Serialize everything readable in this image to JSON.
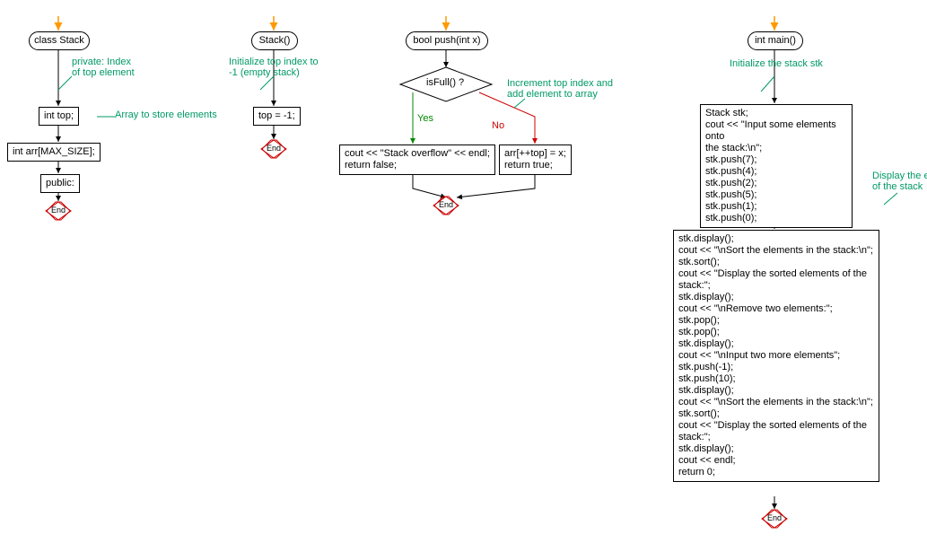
{
  "fc1": {
    "title": "class Stack",
    "ann1": "private: Index\nof top element",
    "n1": "int top;",
    "ann2": "Array to store elements",
    "n2": "int arr[MAX_SIZE];",
    "n3": "public:",
    "end": "End"
  },
  "fc2": {
    "title": "Stack()",
    "ann1": "Initialize top index to\n-1 (empty stack)",
    "n1": "top = -1;",
    "end": "End"
  },
  "fc3": {
    "title": "bool push(int x)",
    "cond": "isFull() ?",
    "yes": "Yes",
    "no": "No",
    "ann1": "Increment top index and\nadd element to array",
    "left": "cout << \"Stack overflow\" << endl;\nreturn false;",
    "right": "arr[++top] = x;\nreturn true;",
    "end": "End"
  },
  "fc4": {
    "title": "int main()",
    "ann1": "Initialize the stack stk",
    "block1": "Stack stk;\ncout << \"Input some elements onto\nthe stack:\\n\";\nstk.push(7);\nstk.push(4);\nstk.push(2);\nstk.push(5);\nstk.push(1);\nstk.push(0);",
    "ann2": "Display the elements\nof the stack",
    "block2": "stk.display();\ncout << \"\\nSort the elements in the stack:\\n\";\nstk.sort();\ncout << \"Display the sorted elements of the\nstack:\";\nstk.display();\ncout << \"\\nRemove two elements:\";\nstk.pop();\nstk.pop();\nstk.display();\ncout << \"\\nInput two more elements\";\nstk.push(-1);\nstk.push(10);\nstk.display();\ncout << \"\\nSort the elements in the stack:\\n\";\nstk.sort();\ncout << \"Display the sorted elements of the\nstack:\";\nstk.display();\ncout << endl;\nreturn 0;",
    "end": "End"
  }
}
